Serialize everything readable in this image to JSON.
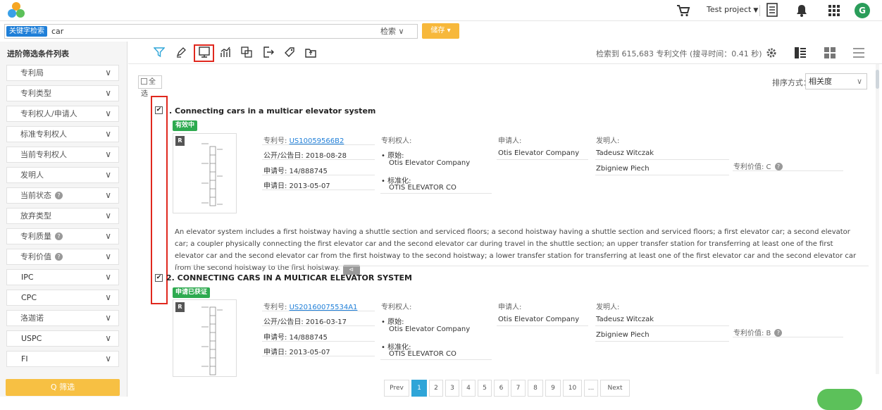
{
  "topbar": {
    "project_label": "Test project",
    "project_caret": "▼",
    "avatar_letter": "G"
  },
  "search": {
    "keyword_tag": "关键字检索",
    "query": "car",
    "search_button": "检索 ∨",
    "save_button": "储存 ▾"
  },
  "sidebar": {
    "title": "进阶筛选条件列表",
    "items": [
      {
        "label": "专利局"
      },
      {
        "label": "专利类型"
      },
      {
        "label": "专利权人/申请人"
      },
      {
        "label": "标准专利权人"
      },
      {
        "label": "当前专利权人"
      },
      {
        "label": "发明人"
      },
      {
        "label": "当前状态"
      },
      {
        "label": "放弃类型"
      },
      {
        "label": "专利质量"
      },
      {
        "label": "专利价值"
      },
      {
        "label": "IPC"
      },
      {
        "label": "CPC"
      },
      {
        "label": "洛迦诺"
      },
      {
        "label": "USPC"
      },
      {
        "label": "FI"
      }
    ],
    "help_mark": "?",
    "chevron": "∨",
    "filter_button": "Q 筛选"
  },
  "toolbar": {
    "result_count": "检索到 615,683 专利文件 (搜寻时间：0.41 秒)"
  },
  "list": {
    "select_all": "全选",
    "sort_label": "排序方式：",
    "sort_value": "相关度",
    "sort_chevron": "∨",
    "results": [
      {
        "index_title": ". Connecting cars in a multicar elevator system",
        "status": "有效中",
        "r_badge": "R",
        "patent_no_label": "专利号:",
        "patent_no": "US10059566B2",
        "pub_date": "公开/公告日: 2018-08-28",
        "app_no": "申请号: 14/888745",
        "app_date": "申请日: 2013-05-07",
        "assignee_label": "专利权人:",
        "original_label": "• 原始:",
        "original_value": "Otis Elevator Company",
        "standard_label": "• 标准化:",
        "standard_value": "OTIS ELEVATOR CO",
        "applicant_label": "申请人:",
        "applicant_value": "Otis Elevator Company",
        "inventor_label": "发明人:",
        "inventor_1": "Tadeusz Witczak",
        "inventor_2": "Zbigniew Piech",
        "value_label": "专利价值: C",
        "abstract": "An elevator system includes a first hoistway having a shuttle section and serviced floors; a second hoistway having a shuttle section and serviced floors; a first elevator car; a second elevator car; a coupler physically connecting the first elevator car and the second elevator car during travel in the shuttle section; an upper transfer station for transferring at least one of the first elevator car and the second elevator car from the first hoistway to the second hoistway; a lower transfer station for transferring at least one of the first elevator car and the second elevator car from the second hoistway to the first hoistway."
      },
      {
        "index_title": "2. CONNECTING CARS IN A MULTICAR ELEVATOR SYSTEM",
        "status": "申请已获证",
        "r_badge": "R",
        "patent_no_label": "专利号:",
        "patent_no": "US20160075534A1",
        "pub_date": "公开/公告日: 2016-03-17",
        "app_no": "申请号: 14/888745",
        "app_date": "申请日: 2013-05-07",
        "assignee_label": "专利权人:",
        "original_label": "• 原始:",
        "original_value": "Otis Elevator Company",
        "standard_label": "• 标准化:",
        "standard_value": "OTIS ELEVATOR CO",
        "applicant_label": "申请人:",
        "applicant_value": "Otis Elevator Company",
        "inventor_label": "发明人:",
        "inventor_1": "Tadeusz Witczak",
        "inventor_2": "Zbigniew Piech",
        "value_label": "专利价值: B"
      }
    ]
  },
  "pagination": {
    "prev": "Prev",
    "pages": [
      "1",
      "2",
      "3",
      "4",
      "5",
      "6",
      "7",
      "8",
      "9",
      "10",
      "..."
    ],
    "next": "Next",
    "current": "1"
  },
  "colors": {
    "accent_blue": "#1f7fd8",
    "save_orange": "#f7b83b",
    "status_green": "#2daa4f",
    "highlight_red": "#e0281e",
    "page_active": "#2fa5d8"
  }
}
